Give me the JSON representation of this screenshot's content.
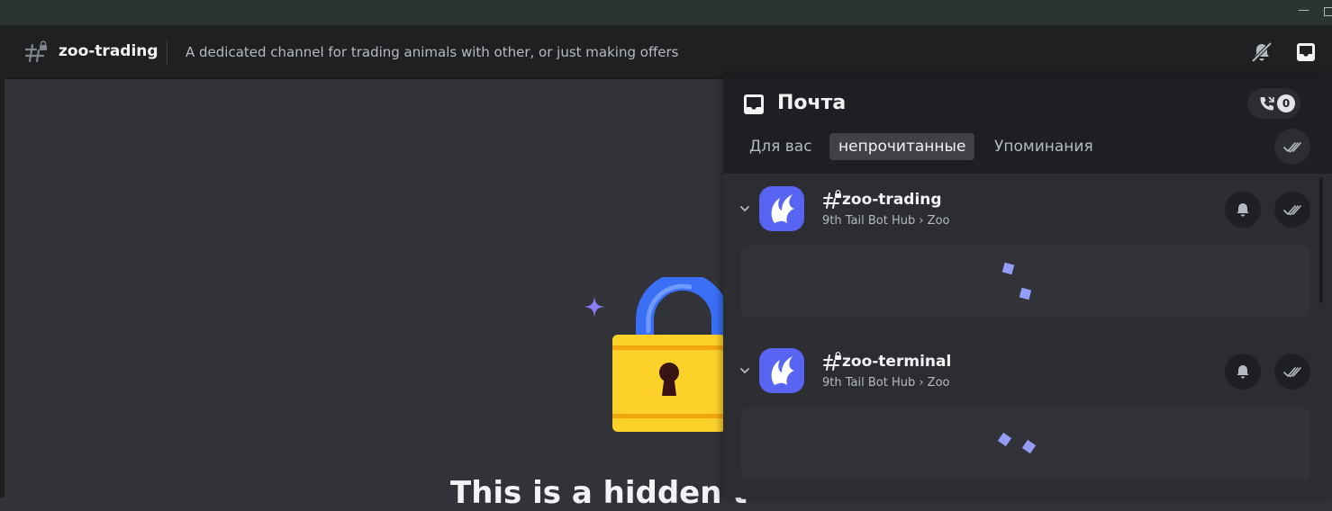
{
  "channel": {
    "name": "zoo-trading",
    "topic": "A dedicated channel for trading animals with other, or just making offers"
  },
  "main": {
    "hidden_title": "This is a hidden t"
  },
  "inbox": {
    "title": "Почта",
    "calls_count": "0",
    "tabs": [
      {
        "label": "Для вас",
        "selected": false
      },
      {
        "label": "непрочитанные",
        "selected": true
      },
      {
        "label": "Упоминания",
        "selected": false
      }
    ],
    "groups": [
      {
        "channel": "zoo-trading",
        "server_path": "9th Tail Bot Hub › Zoo",
        "loading": true
      },
      {
        "channel": "zoo-terminal",
        "server_path": "9th Tail Bot Hub › Zoo",
        "loading": true
      }
    ]
  },
  "icons": {
    "header": [
      "locked-hash-icon",
      "mute-bell-icon",
      "inbox-icon"
    ],
    "inbox": [
      "inbox-icon",
      "phone-icon",
      "double-check-icon"
    ],
    "group": [
      "chevron-down-icon",
      "server-logo-icon",
      "locked-hash-icon",
      "bell-icon",
      "double-check-icon"
    ]
  },
  "colors": {
    "accent": "#5865f2",
    "loader": "#949cf7",
    "lock_body": "#fcd12a",
    "lock_shackle": "#3a6ff5",
    "sparkle": "#8b7cf6"
  }
}
